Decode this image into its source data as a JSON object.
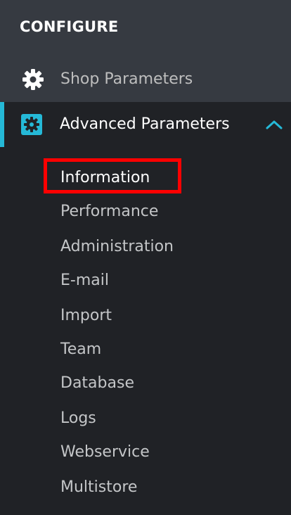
{
  "section": {
    "title": "CONFIGURE"
  },
  "menu": {
    "shop_parameters": {
      "label": "Shop Parameters",
      "icon": "gear-icon"
    },
    "advanced_parameters": {
      "label": "Advanced Parameters",
      "icon": "gear-square-icon",
      "accent_color": "#25b9d7",
      "expanded": true
    },
    "submenu": [
      {
        "label": "Information",
        "active": true
      },
      {
        "label": "Performance"
      },
      {
        "label": "Administration"
      },
      {
        "label": "E-mail"
      },
      {
        "label": "Import"
      },
      {
        "label": "Team"
      },
      {
        "label": "Database"
      },
      {
        "label": "Logs"
      },
      {
        "label": "Webservice"
      },
      {
        "label": "Multistore"
      }
    ]
  },
  "annotation": {
    "highlight_color": "#ff0000",
    "highlighted_item": "Information"
  }
}
